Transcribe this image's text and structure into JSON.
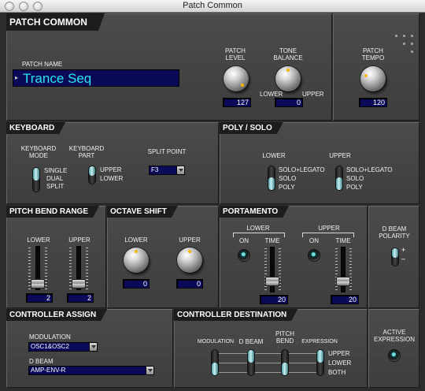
{
  "window": {
    "title": "Patch Common"
  },
  "patch_common": {
    "header": "PATCH COMMON",
    "patch_name_label": "PATCH NAME",
    "patch_name": "Trance Seq",
    "patch_level": {
      "label": "PATCH LEVEL",
      "value": "127"
    },
    "tone_balance": {
      "label": "TONE BALANCE",
      "lower": "LOWER",
      "upper": "UPPER",
      "value": "0"
    },
    "patch_tempo": {
      "label": "PATCH TEMPO",
      "value": "120"
    }
  },
  "keyboard": {
    "header": "KEYBOARD",
    "mode_label": "KEYBOARD MODE",
    "mode_options": [
      "SINGLE",
      "DUAL",
      "SPLIT"
    ],
    "part_label": "KEYBOARD PART",
    "part_options": [
      "UPPER",
      "LOWER"
    ],
    "split_point_label": "SPLIT POINT",
    "split_point": "F3"
  },
  "poly_solo": {
    "header": "POLY / SOLO",
    "lower_label": "LOWER",
    "upper_label": "UPPER",
    "options": [
      "SOLO+LEGATO",
      "SOLO",
      "POLY"
    ]
  },
  "pitch_bend": {
    "header": "PITCH BEND RANGE",
    "lower_label": "LOWER",
    "upper_label": "UPPER",
    "lower_value": "2",
    "upper_value": "2"
  },
  "octave_shift": {
    "header": "OCTAVE SHIFT",
    "lower_label": "LOWER",
    "upper_label": "UPPER",
    "lower_value": "0",
    "upper_value": "0"
  },
  "portamento": {
    "header": "PORTAMENTO",
    "lower_label": "LOWER",
    "upper_label": "UPPER",
    "on_label": "ON",
    "time_label": "TIME",
    "lower_time": "20",
    "upper_time": "20"
  },
  "dbeam_polarity": {
    "label": "D BEAM POLARITY",
    "plus": "+",
    "minus": "–"
  },
  "controller_assign": {
    "header": "CONTROLLER ASSIGN",
    "modulation_label": "MODULATION",
    "modulation_value": "OSC1&OSC2",
    "dbeam_label": "D BEAM",
    "dbeam_value": "AMP-ENV-R"
  },
  "controller_destination": {
    "header": "CONTROLLER DESTINATION",
    "modulation": "MODULATION",
    "dbeam": "D BEAM",
    "pitch_bend": "PITCH BEND",
    "expression": "EXPRESSION",
    "options": [
      "UPPER",
      "LOWER",
      "BOTH"
    ]
  },
  "active_expression": {
    "label": "ACTIVE EXPRESSION"
  }
}
